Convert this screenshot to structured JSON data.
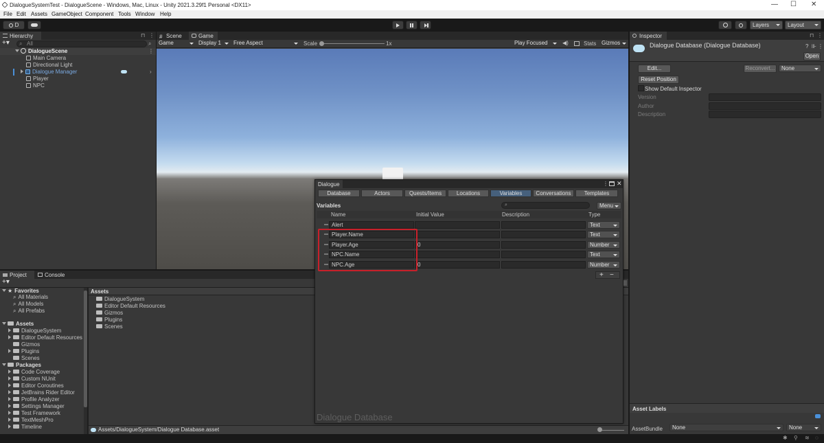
{
  "window": {
    "title": "DialogueSystemTest - DialogueScene - Windows, Mac, Linux - Unity 2021.3.29f1 Personal <DX11>",
    "min": "—",
    "max": "☐",
    "close": "✕"
  },
  "menu": [
    "File",
    "Edit",
    "Assets",
    "GameObject",
    "Component",
    "Tools",
    "Window",
    "Help"
  ],
  "toolbar": {
    "account": "D",
    "layers": "Layers",
    "layout": "Layout"
  },
  "hierarchy": {
    "tab": "Hierarchy",
    "search_placeholder": "All",
    "scene": "DialogueScene",
    "items": [
      "Main Camera",
      "Directional Light",
      "Dialogue Manager",
      "Player",
      "NPC"
    ]
  },
  "scene_tabs": {
    "scene": "Scene",
    "game": "Game"
  },
  "game_bar": {
    "game": "Game",
    "display": "Display 1",
    "aspect": "Free Aspect",
    "scale_label": "Scale",
    "scale_value": "1x",
    "play_focused": "Play Focused",
    "stats": "Stats",
    "gizmos": "Gizmos"
  },
  "project": {
    "tab_project": "Project",
    "tab_console": "Console",
    "favorites": "Favorites",
    "fav_items": [
      "All Materials",
      "All Models",
      "All Prefabs"
    ],
    "assets": "Assets",
    "asset_items": [
      "DialogueSystem",
      "Editor Default Resources",
      "Gizmos",
      "Plugins",
      "Scenes"
    ],
    "packages": "Packages",
    "package_items": [
      "Code Coverage",
      "Custom NUnit",
      "Editor Coroutines",
      "JetBrains Rider Editor",
      "Profile Analyzer",
      "Settings Manager",
      "Test Framework",
      "TextMeshPro",
      "Timeline"
    ],
    "assets_header": "Assets",
    "path": "Assets/DialogueSystem/Dialogue Database.asset"
  },
  "dialogue": {
    "title": "Dialogue",
    "tabs": [
      "Database",
      "Actors",
      "Quests/Items",
      "Locations",
      "Variables",
      "Conversations",
      "Templates"
    ],
    "active_tab": "Variables",
    "section": "Variables",
    "menu": "Menu",
    "columns": {
      "name": "Name",
      "initial": "Initial Value",
      "description": "Description",
      "type": "Type"
    },
    "rows": [
      {
        "name": "Alert",
        "initial": "",
        "type": "Text"
      },
      {
        "name": "Player.Name",
        "initial": "",
        "type": "Text"
      },
      {
        "name": "Player.Age",
        "initial": "0",
        "type": "Number"
      },
      {
        "name": "NPC.Name",
        "initial": "",
        "type": "Text"
      },
      {
        "name": "NPC.Age",
        "initial": "0",
        "type": "Number"
      }
    ],
    "add": "+",
    "remove": "−",
    "watermark": "Dialogue Database",
    "highlight_color": "#c8202a"
  },
  "inspector": {
    "tab": "Inspector",
    "asset_title": "Dialogue Database (Dialogue Database)",
    "open": "Open",
    "edit": "Edit...",
    "reconvert": "Reconvert...",
    "none": "None",
    "reset": "Reset Position",
    "show_default": "Show Default Inspector",
    "fields": [
      "Version",
      "Author",
      "Description"
    ],
    "asset_labels": "Asset Labels",
    "assetbundle": "AssetBundle",
    "bundle_none": "None",
    "variant_none": "None"
  }
}
